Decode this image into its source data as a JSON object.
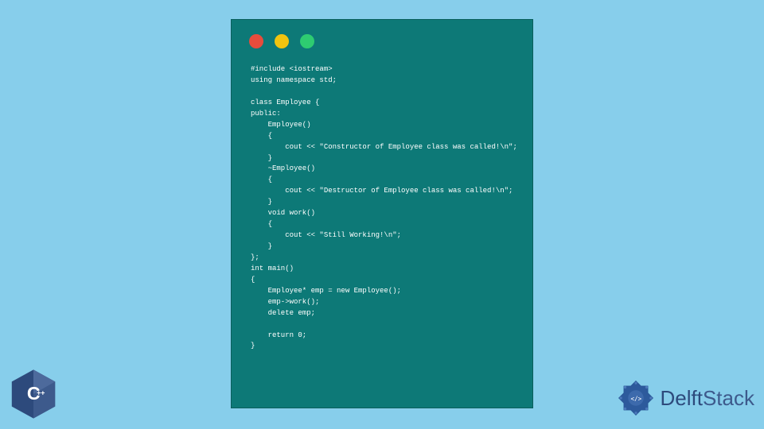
{
  "code": {
    "lines": "#include <iostream>\nusing namespace std;\n\nclass Employee {\npublic:\n    Employee()\n    {\n        cout << \"Constructor of Employee class was called!\\n\";\n    }\n    ~Employee()\n    {\n        cout << \"Destructor of Employee class was called!\\n\";\n    }\n    void work()\n    {\n        cout << \"Still Working!\\n\";\n    }\n};\nint main()\n{\n    Employee* emp = new Employee();\n    emp->work();\n    delete emp;\n\n    return 0;\n}"
  },
  "branding": {
    "cpp_label": "C++",
    "delft_text_1": "Delft",
    "delft_text_2": "Stack"
  }
}
